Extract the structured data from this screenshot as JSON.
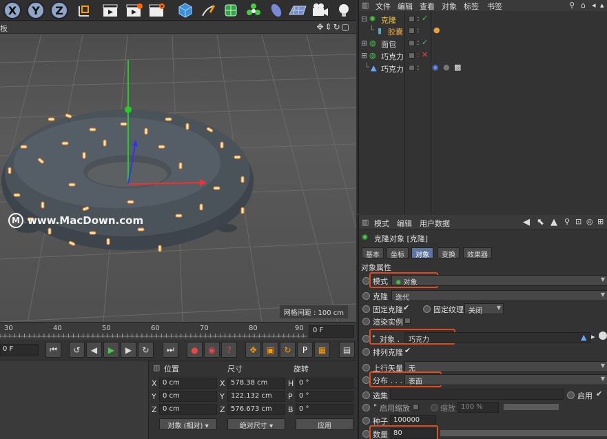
{
  "toolbar": {
    "axis_x": "X",
    "axis_y": "Y",
    "axis_z": "Z",
    "icons": [
      "coord-system-icon",
      "render-view-icon",
      "render-picture-icon",
      "render-settings-icon",
      "cube-icon",
      "pen-icon",
      "subdivision-icon",
      "cloner-icon",
      "deformer-icon",
      "floor-icon",
      "camera-icon",
      "light-icon"
    ]
  },
  "viewport": {
    "label": "板",
    "grid_info": "网格间距 : 100 cm",
    "watermark": "www.MacDown.com",
    "watermark_logo": "M"
  },
  "timeline": {
    "ticks": [
      "30",
      "40",
      "50",
      "60",
      "70",
      "80",
      "90"
    ],
    "current_frame": "0 F",
    "start_frame": "0 F"
  },
  "coords": {
    "header_position": "位置",
    "header_size": "尺寸",
    "header_rotation": "旋转",
    "rows": [
      {
        "axis": "X",
        "pos": "0 cm",
        "size_axis": "X",
        "size": "578.38 cm",
        "rot_axis": "H",
        "rot": "0 °"
      },
      {
        "axis": "Y",
        "pos": "0 cm",
        "size_axis": "Y",
        "size": "122.132 cm",
        "rot_axis": "P",
        "rot": "0 °"
      },
      {
        "axis": "Z",
        "pos": "0 cm",
        "size_axis": "Z",
        "size": "576.673 cm",
        "rot_axis": "B",
        "rot": "0 °"
      }
    ],
    "mode_dropdown": "对象 (相对)",
    "size_dropdown": "绝对尺寸",
    "apply_button": "应用"
  },
  "object_manager": {
    "menu": [
      "文件",
      "编辑",
      "查看",
      "对象",
      "标签",
      "书签"
    ],
    "objects": [
      {
        "name": "克隆",
        "color": "#f5c542",
        "icon": "cloner-icon"
      },
      {
        "name": "胶囊",
        "color": "#e8a33c",
        "icon": "capsule-icon"
      },
      {
        "name": "面包",
        "color": "#dddddd",
        "icon": "torus-icon"
      },
      {
        "name": "巧克力",
        "color": "#dddddd",
        "icon": "subdivision-icon"
      },
      {
        "name": "巧克力",
        "color": "#dddddd",
        "icon": "polygon-object-icon"
      }
    ]
  },
  "attributes": {
    "menu": [
      "模式",
      "编辑",
      "用户数据"
    ],
    "title": "克隆对象 [克隆]",
    "tabs": [
      "基本",
      "坐标",
      "对象",
      "变换",
      "效果器"
    ],
    "section": "对象属性",
    "mode_label": "模式",
    "mode_value": "对象",
    "clone_label": "克隆",
    "clone_value": "迭代",
    "fixed_clone_label": "固定克隆",
    "fixed_texture_label": "固定纹理",
    "fixed_texture_value": "关闭",
    "render_instance_label": "渲染实例",
    "object_label": "对象 .",
    "object_value": "巧克力",
    "align_clone_label": "排列克隆",
    "up_vector_label": "上行矢量",
    "up_vector_value": "无",
    "distribution_label": "分布 . . .",
    "distribution_value": "表面",
    "selection_label": "选集",
    "enable_label": "启用",
    "enable_scale_label": "启用缩放",
    "scale_label": "缩放",
    "scale_value": "100 %",
    "seed_label": "种子",
    "seed_value": "100000",
    "count_label": "数量",
    "count_value": "80"
  },
  "colors": {
    "highlight": "#e04a1f",
    "active_tab": "#5d74a0",
    "axis_x": "#e33",
    "axis_y": "#2c2",
    "axis_z": "#33e"
  }
}
